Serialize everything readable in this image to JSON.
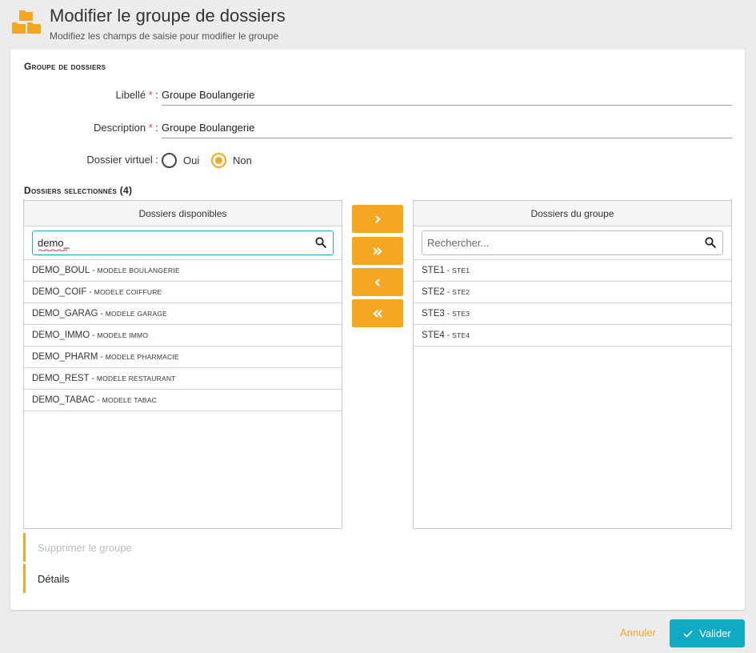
{
  "header": {
    "title": "Modifier le groupe de dossiers",
    "subtitle": "Modifiez les champs de saisie pour modifier le groupe",
    "icon": "folders-icon"
  },
  "form": {
    "section_title": "Groupe de dossiers",
    "libelle": {
      "label": "Libellé",
      "required_mark": "*",
      "colon": ":",
      "value": "Groupe Boulangerie"
    },
    "description": {
      "label": "Description",
      "required_mark": "*",
      "colon": ":",
      "value": "Groupe Boulangerie"
    },
    "virtual": {
      "label": "Dossier virtuel :",
      "options": [
        {
          "label": "Oui",
          "checked": false
        },
        {
          "label": "Non",
          "checked": true
        }
      ]
    }
  },
  "selection": {
    "section_title": "Dossiers selectionnés (4)",
    "available": {
      "header": "Dossiers disponibles",
      "search_value": "demo_",
      "search_placeholder": "",
      "items": [
        {
          "code": "DEMO_BOUL",
          "desc": "Modele Boulangerie"
        },
        {
          "code": "DEMO_COIF",
          "desc": "Modele Coiffure"
        },
        {
          "code": "DEMO_GARAG",
          "desc": "Modele Garage"
        },
        {
          "code": "DEMO_IMMO",
          "desc": "Modele Immo"
        },
        {
          "code": "DEMO_PHARM",
          "desc": "Modele Pharmacie"
        },
        {
          "code": "DEMO_REST",
          "desc": "Modele Restaurant"
        },
        {
          "code": "DEMO_TABAC",
          "desc": "Modele Tabac"
        }
      ]
    },
    "group": {
      "header": "Dossiers du groupe",
      "search_value": "",
      "search_placeholder": "Rechercher...",
      "items": [
        {
          "code": "STE1",
          "desc": "Ste1"
        },
        {
          "code": "STE2",
          "desc": "Ste2"
        },
        {
          "code": "STE3",
          "desc": "Ste3"
        },
        {
          "code": "STE4",
          "desc": "Ste4"
        }
      ]
    },
    "transfer": {
      "move_right": "›",
      "move_all_right": "»",
      "move_left": "‹",
      "move_all_left": "«"
    }
  },
  "tabs": {
    "delete_group": "Supprimer le groupe",
    "details": "Détails"
  },
  "footer": {
    "cancel_label": "Annuler",
    "validate_label": "Valider"
  },
  "colors": {
    "accent": "#f5a623",
    "primary": "#12a9c4",
    "required": "#e53935"
  }
}
